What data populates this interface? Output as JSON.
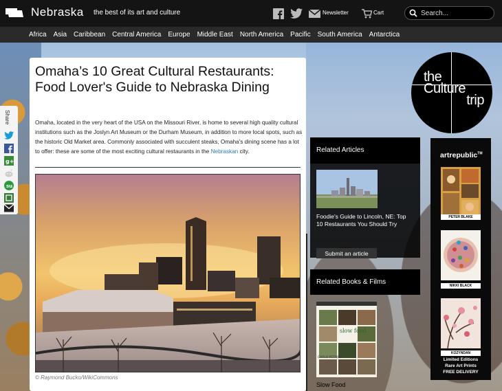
{
  "header": {
    "site_title": "Nebraska",
    "tagline": "the best of its art and culture",
    "newsletter_label": "Newsletter",
    "cart_label": "Cart",
    "search_placeholder": "Search..."
  },
  "nav": {
    "items": [
      "Africa",
      "Asia",
      "Caribbean",
      "Central America",
      "Europe",
      "Middle East",
      "North America",
      "Pacific",
      "South America",
      "Antarctica"
    ]
  },
  "share": {
    "label": "Share"
  },
  "article": {
    "title": "Omaha’s 10 Great Cultural Restaurants: Food Lover's Guide to Nebraska Dining",
    "intro_before_link": "Omaha, located in the very heart of the USA on the Missouri River, is home to several high quality cultural institutions such as the Joslyn Art Museum or the Durham Museum, in addition to more local spots, such as the historic Old Market area. Commonly associated with succulent steaks, Omaha's dining scene has a lot to offer: these are some of the most exciting cultural restaurants in the ",
    "intro_link": "Nebraskan",
    "intro_after_link": " city.",
    "photo_credit": "© Raymond Bucko/WikiCommons"
  },
  "logo": {
    "line1": "the",
    "line2": "Culture",
    "line3": "trip"
  },
  "related_articles": {
    "title": "Related Articles",
    "item_text": "Foodie's Guide to Lincoln, NE: Top 10 Restaurants You Should Try",
    "submit_label": "Submit an article"
  },
  "related_books": {
    "title": "Related Books & Films",
    "book_title": "Slow Food",
    "cover_author": "CARLO PETRINI",
    "cover_title": "slow food"
  },
  "ad": {
    "brand": "artrepublic",
    "tm": "TM",
    "artists": [
      "PETER BLAKE",
      "NIKKI BLACK",
      "KOZYNDAN"
    ],
    "footer_lines": [
      "Limited Editions",
      "Rare Art Prints",
      "FREE DELIVERY"
    ]
  },
  "colors": {
    "header_bg": "#141414",
    "nav_bg": "#2a2a2a",
    "link": "#2a7ab8"
  }
}
